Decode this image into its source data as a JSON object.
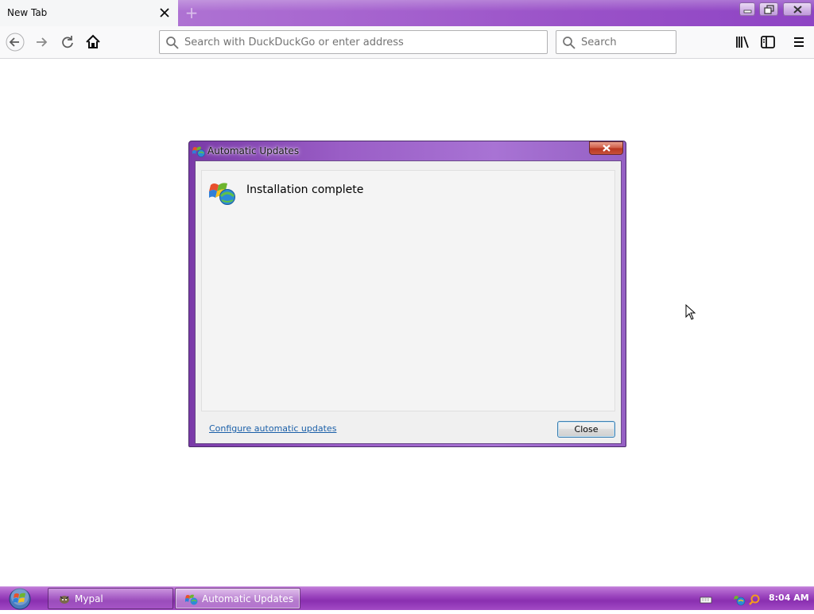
{
  "browser": {
    "tab_title": "New Tab",
    "urlbar_placeholder": "Search with DuckDuckGo or enter address",
    "searchbar_placeholder": "Search"
  },
  "dialog": {
    "title": "Automatic Updates",
    "heading": "Installation complete",
    "link_text": "Configure automatic updates",
    "close_button": "Close"
  },
  "taskbar": {
    "items": [
      {
        "label": "Mypal",
        "active": false
      },
      {
        "label": "Automatic Updates",
        "active": true
      }
    ],
    "clock": "8:04 AM"
  },
  "icons": {
    "nav": [
      "back-icon",
      "forward-icon",
      "reload-icon",
      "home-icon"
    ],
    "toolbar": [
      "library-icon",
      "sidebar-icon",
      "menu-icon"
    ],
    "tray": [
      "keyboard-icon",
      "network-icon",
      "search-icon"
    ]
  },
  "colors": {
    "theme_purple": "#9a52c8",
    "link_blue": "#1a5fa8"
  }
}
